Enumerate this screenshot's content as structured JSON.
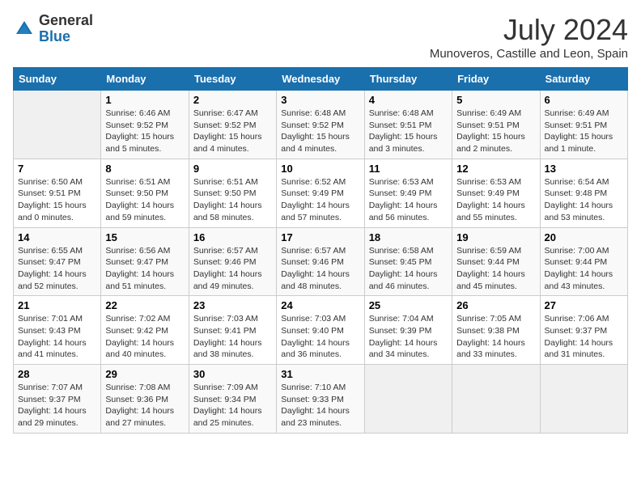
{
  "logo": {
    "general": "General",
    "blue": "Blue"
  },
  "title": {
    "month_year": "July 2024",
    "location": "Munoveros, Castille and Leon, Spain"
  },
  "days_of_week": [
    "Sunday",
    "Monday",
    "Tuesday",
    "Wednesday",
    "Thursday",
    "Friday",
    "Saturday"
  ],
  "weeks": [
    [
      {
        "day": "",
        "empty": true
      },
      {
        "day": "1",
        "sunrise": "6:46 AM",
        "sunset": "9:52 PM",
        "daylight": "15 hours and 5 minutes."
      },
      {
        "day": "2",
        "sunrise": "6:47 AM",
        "sunset": "9:52 PM",
        "daylight": "15 hours and 4 minutes."
      },
      {
        "day": "3",
        "sunrise": "6:48 AM",
        "sunset": "9:52 PM",
        "daylight": "15 hours and 4 minutes."
      },
      {
        "day": "4",
        "sunrise": "6:48 AM",
        "sunset": "9:51 PM",
        "daylight": "15 hours and 3 minutes."
      },
      {
        "day": "5",
        "sunrise": "6:49 AM",
        "sunset": "9:51 PM",
        "daylight": "15 hours and 2 minutes."
      },
      {
        "day": "6",
        "sunrise": "6:49 AM",
        "sunset": "9:51 PM",
        "daylight": "15 hours and 1 minute."
      }
    ],
    [
      {
        "day": "7",
        "sunrise": "6:50 AM",
        "sunset": "9:51 PM",
        "daylight": "15 hours and 0 minutes."
      },
      {
        "day": "8",
        "sunrise": "6:51 AM",
        "sunset": "9:50 PM",
        "daylight": "14 hours and 59 minutes."
      },
      {
        "day": "9",
        "sunrise": "6:51 AM",
        "sunset": "9:50 PM",
        "daylight": "14 hours and 58 minutes."
      },
      {
        "day": "10",
        "sunrise": "6:52 AM",
        "sunset": "9:49 PM",
        "daylight": "14 hours and 57 minutes."
      },
      {
        "day": "11",
        "sunrise": "6:53 AM",
        "sunset": "9:49 PM",
        "daylight": "14 hours and 56 minutes."
      },
      {
        "day": "12",
        "sunrise": "6:53 AM",
        "sunset": "9:49 PM",
        "daylight": "14 hours and 55 minutes."
      },
      {
        "day": "13",
        "sunrise": "6:54 AM",
        "sunset": "9:48 PM",
        "daylight": "14 hours and 53 minutes."
      }
    ],
    [
      {
        "day": "14",
        "sunrise": "6:55 AM",
        "sunset": "9:47 PM",
        "daylight": "14 hours and 52 minutes."
      },
      {
        "day": "15",
        "sunrise": "6:56 AM",
        "sunset": "9:47 PM",
        "daylight": "14 hours and 51 minutes."
      },
      {
        "day": "16",
        "sunrise": "6:57 AM",
        "sunset": "9:46 PM",
        "daylight": "14 hours and 49 minutes."
      },
      {
        "day": "17",
        "sunrise": "6:57 AM",
        "sunset": "9:46 PM",
        "daylight": "14 hours and 48 minutes."
      },
      {
        "day": "18",
        "sunrise": "6:58 AM",
        "sunset": "9:45 PM",
        "daylight": "14 hours and 46 minutes."
      },
      {
        "day": "19",
        "sunrise": "6:59 AM",
        "sunset": "9:44 PM",
        "daylight": "14 hours and 45 minutes."
      },
      {
        "day": "20",
        "sunrise": "7:00 AM",
        "sunset": "9:44 PM",
        "daylight": "14 hours and 43 minutes."
      }
    ],
    [
      {
        "day": "21",
        "sunrise": "7:01 AM",
        "sunset": "9:43 PM",
        "daylight": "14 hours and 41 minutes."
      },
      {
        "day": "22",
        "sunrise": "7:02 AM",
        "sunset": "9:42 PM",
        "daylight": "14 hours and 40 minutes."
      },
      {
        "day": "23",
        "sunrise": "7:03 AM",
        "sunset": "9:41 PM",
        "daylight": "14 hours and 38 minutes."
      },
      {
        "day": "24",
        "sunrise": "7:03 AM",
        "sunset": "9:40 PM",
        "daylight": "14 hours and 36 minutes."
      },
      {
        "day": "25",
        "sunrise": "7:04 AM",
        "sunset": "9:39 PM",
        "daylight": "14 hours and 34 minutes."
      },
      {
        "day": "26",
        "sunrise": "7:05 AM",
        "sunset": "9:38 PM",
        "daylight": "14 hours and 33 minutes."
      },
      {
        "day": "27",
        "sunrise": "7:06 AM",
        "sunset": "9:37 PM",
        "daylight": "14 hours and 31 minutes."
      }
    ],
    [
      {
        "day": "28",
        "sunrise": "7:07 AM",
        "sunset": "9:37 PM",
        "daylight": "14 hours and 29 minutes."
      },
      {
        "day": "29",
        "sunrise": "7:08 AM",
        "sunset": "9:36 PM",
        "daylight": "14 hours and 27 minutes."
      },
      {
        "day": "30",
        "sunrise": "7:09 AM",
        "sunset": "9:34 PM",
        "daylight": "14 hours and 25 minutes."
      },
      {
        "day": "31",
        "sunrise": "7:10 AM",
        "sunset": "9:33 PM",
        "daylight": "14 hours and 23 minutes."
      },
      {
        "day": "",
        "empty": true
      },
      {
        "day": "",
        "empty": true
      },
      {
        "day": "",
        "empty": true
      }
    ]
  ]
}
